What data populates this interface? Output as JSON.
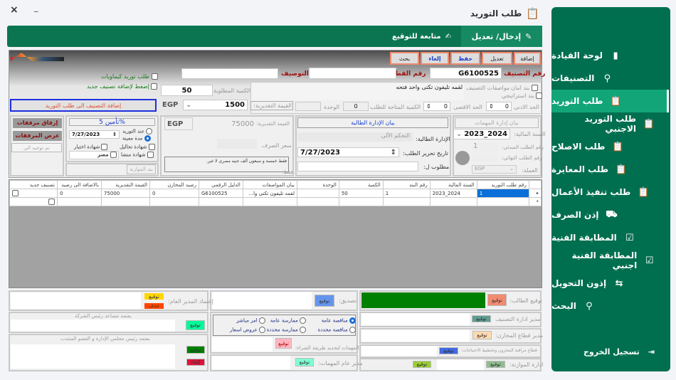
{
  "window": {
    "title": "طلب التوريد",
    "close": "×",
    "minimize": "_"
  },
  "tabs": [
    {
      "label": "إدخال/ تعديل",
      "active": true
    },
    {
      "label": "متابعة للتوقيع",
      "active": false
    }
  ],
  "sidebar": {
    "items": [
      {
        "label": "لوحة القيادة",
        "icon": "bar-chart-icon"
      },
      {
        "label": "التصنيفات",
        "icon": "search-icon"
      },
      {
        "label": "طلب التوريد",
        "icon": "clipboard-icon",
        "active": true
      },
      {
        "label": "طلب التوريد الاجنبي",
        "icon": "clipboard-icon"
      },
      {
        "label": "طلب الاصلاح",
        "icon": "clipboard-icon"
      },
      {
        "label": "طلب المعايرة",
        "icon": "clipboard-icon"
      },
      {
        "label": "طلب تنفيذ الأعمال",
        "icon": "clipboard-icon"
      },
      {
        "label": "إذن الصرف",
        "icon": "cart-icon"
      },
      {
        "label": "المطابقة الفنية",
        "icon": "clipboard-check-icon"
      },
      {
        "label": "المطابقة الفنية اجنبي",
        "icon": "clipboard-check-icon"
      },
      {
        "label": "إذون التحويل",
        "icon": "transfer-icon"
      },
      {
        "label": "البحث",
        "icon": "search-icon"
      }
    ],
    "logout": "تسجيل الخروج"
  },
  "toolbar": {
    "add": "إضافة",
    "edit": "تعديل",
    "save": "حفظ",
    "cancel": "إلغاء",
    "search": "بحث"
  },
  "item": {
    "class_no_label": "رقم التصنيف",
    "class_no": "G6100525",
    "part_no_label": "رقم القطعة",
    "part_no": "",
    "desc_label": "التوصيف",
    "desc": "",
    "chem_request": "طلب توريد كيماويات",
    "add_new_class": "إضغط لإضافة تصنيف جديد",
    "safety": "بند امان",
    "strategic": "بند استراتيجي",
    "specs_label": "مواصفات التصنيف",
    "specs": "لقمه تليفون تكتى واحد فتحه",
    "min_label": "الحد الادنى",
    "min": "0",
    "max_label": "الحد الاقصى",
    "max": "0",
    "available_label": "الكمية المتاحة للطلب",
    "available": "0",
    "unit_label": "الوحدة",
    "unit": "",
    "est_label": "القيمة التقديرية:",
    "qty_label": "الكمية المطلوبة",
    "qty": "50",
    "currency": "EGP",
    "unit_price": "1500",
    "add_to_request": "إضافة التصنيف الى طلب التوريد"
  },
  "mgmt": {
    "header": "بيان إدارة المهمات",
    "fy_label": "السنة المالية:",
    "fy": "2023_2024",
    "init_no_label": "رقم الطلب المبدئي:",
    "init_no": "1",
    "final_no_label": "رقم الطلب النهائي:",
    "final_no": "",
    "currency_label": "العملة:",
    "currency": "EGP"
  },
  "dept": {
    "header": "بيان الإدارة الطالبة",
    "dept_label": "الإدارة الطالبة:",
    "dept": "التحكم الآلى",
    "date_label": "تاريخ تحرير الطلب:",
    "date": "7/27/2023",
    "for_label": "مطلوب ل:",
    "for": ""
  },
  "value": {
    "currency": "EGP",
    "est_label": "القيمة التقديرية:",
    "est": "75000",
    "rate_label": "سعر الصرف",
    "words_label": "فقط:",
    "words": "فقط خمسة و سبعون ألف جنيه مصرى لا غير."
  },
  "insurance": {
    "title": "%تأمين 5",
    "on_delivery": "عند التوريد",
    "period": "مدة معينة",
    "date": "7/27/2023",
    "analysis": "شهادة تحاليل",
    "test": "شهادة اختبار",
    "origin": "شهادة منشا",
    "origin_country": "مصر",
    "budget_item": "بند الموازنة"
  },
  "attachments": {
    "attach": "إرفاق مرفقات",
    "view": "عرض المرفقات",
    "forwarded": "تم توجيه الى"
  },
  "grid": {
    "columns": [
      "رقم طلب التوريد",
      "السنة المالية",
      "رقم البند",
      "الكمية",
      "الوحدة",
      "بيان المواصفات",
      "الدليل الرقمي",
      "رصيد المخازن",
      "القيمة التقديرية",
      "بالاضافة الى رصيد",
      "تصنيف جديد"
    ],
    "rows": [
      [
        "1",
        "2024_2023",
        "1",
        "50",
        "",
        "لقمه تليفون تكتى وا...",
        "G6100525",
        "0",
        "75000",
        "0",
        ""
      ]
    ]
  },
  "signatures": {
    "sign": "توقيع",
    "delete": "حذف",
    "cancel": "إلغاء",
    "requester": "توقيع الطالب:",
    "class_mgr": "مدير ادارة التصنيف",
    "stores_mgr": "مدير قطاع المخازن:",
    "inventory": "قطاع مراقبة المخزون وتخطيط الاحتياجات:",
    "budget": "ادارة الموازنة:",
    "approval": "تصديق:",
    "purchase_method": "المهمات لتحديد طريقة الشراء:",
    "gm_supplies": "مدير عام المهمات:",
    "gm_approval": "إعتماد المدير العام:",
    "assistant": "يعتمد مساعد رئيس الشركة",
    "chairman": "يعتمد رئيس مجلس الإدارة و العضو المنتدب",
    "methods": [
      "مناقصة عامة",
      "مناقصة محددة",
      "ممارسة عامة",
      "ممارسة محددة",
      "امر مباشر",
      "عروض اسعار"
    ]
  },
  "colors": {
    "sidebar": "#006f4f",
    "sidebar_active": "#12a578",
    "requester_box": "#008000"
  }
}
